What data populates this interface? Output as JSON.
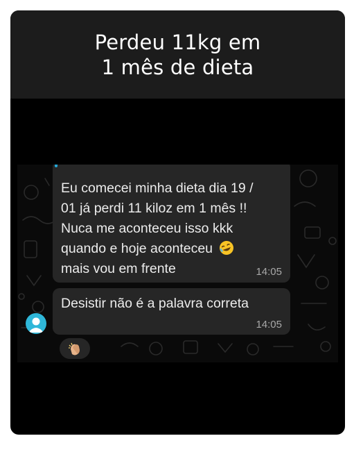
{
  "header": {
    "title": "Perdeu 11kg em\n1 mês de dieta"
  },
  "messages": [
    {
      "text": "Eu comecei minha dieta dia 19 /\n01 já perdi 11 kiloz em 1 mês  !!\nNuca me aconteceu isso kkk\nquando e hoje aconteceu",
      "text_tail": "mais vou em frente",
      "emoji": "rolling-on-floor-laughing",
      "time": "14:05"
    },
    {
      "text": "Desistir não é a palavra correta",
      "time": "14:05",
      "reaction": "clapping-hands"
    }
  ],
  "colors": {
    "header_bg": "#1c1c1c",
    "card_bg": "#000000",
    "bubble_bg": "#262626",
    "accent": "#25a7d6",
    "avatar": "#2fb7d9"
  }
}
